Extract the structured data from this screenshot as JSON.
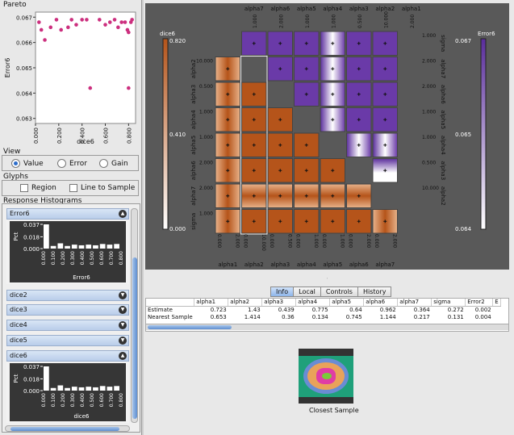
{
  "pareto": {
    "title": "Pareto",
    "ylabel": "Error6",
    "xlabel": "dice6",
    "y_ticks": [
      "0.067",
      "0.066",
      "0.065",
      "0.064",
      "0.063"
    ],
    "x_ticks": [
      "0.000",
      "0.200",
      "0.400",
      "0.600",
      "0.800"
    ],
    "point_color": "#cc2f7e",
    "points": [
      {
        "x": 0.03,
        "y": 0.0668
      },
      {
        "x": 0.05,
        "y": 0.0665
      },
      {
        "x": 0.08,
        "y": 0.0661
      },
      {
        "x": 0.13,
        "y": 0.0666
      },
      {
        "x": 0.18,
        "y": 0.0669
      },
      {
        "x": 0.22,
        "y": 0.0665
      },
      {
        "x": 0.28,
        "y": 0.0666
      },
      {
        "x": 0.31,
        "y": 0.0669
      },
      {
        "x": 0.35,
        "y": 0.0667
      },
      {
        "x": 0.4,
        "y": 0.0669
      },
      {
        "x": 0.44,
        "y": 0.0669
      },
      {
        "x": 0.47,
        "y": 0.0642
      },
      {
        "x": 0.55,
        "y": 0.0669
      },
      {
        "x": 0.6,
        "y": 0.0667
      },
      {
        "x": 0.64,
        "y": 0.0668
      },
      {
        "x": 0.68,
        "y": 0.0669
      },
      {
        "x": 0.71,
        "y": 0.0666
      },
      {
        "x": 0.74,
        "y": 0.0668
      },
      {
        "x": 0.77,
        "y": 0.0668
      },
      {
        "x": 0.79,
        "y": 0.0665
      },
      {
        "x": 0.8,
        "y": 0.0664
      },
      {
        "x": 0.82,
        "y": 0.0668
      },
      {
        "x": 0.8,
        "y": 0.0642
      },
      {
        "x": 0.83,
        "y": 0.0669
      }
    ]
  },
  "view": {
    "title": "View",
    "options": [
      {
        "label": "Value",
        "selected": true
      },
      {
        "label": "Error",
        "selected": false
      },
      {
        "label": "Gain",
        "selected": false
      }
    ]
  },
  "glyphs": {
    "title": "Glyphs",
    "region_label": "Region",
    "line_label": "Line to Sample"
  },
  "histograms": {
    "title": "Response Histograms",
    "error6": {
      "name": "Error6",
      "ylabel": "Pct",
      "xlabel": "Error6",
      "y_ticks": [
        "0.037",
        "0.018",
        "0.000"
      ],
      "x_ticks": [
        "0.000",
        "0.100",
        "0.200",
        "0.300",
        "0.400",
        "0.500",
        "0.600",
        "0.700",
        "0.800"
      ],
      "bars": [
        0.037,
        0.004,
        0.008,
        0.004,
        0.006,
        0.005,
        0.006,
        0.005,
        0.007,
        0.006,
        0.007
      ]
    },
    "collapsed": [
      "dice2",
      "dice3",
      "dice4",
      "dice5"
    ],
    "dice6": {
      "name": "dice6",
      "ylabel": "Pct",
      "xlabel": "dice6",
      "y_ticks": [
        "0.037",
        "0.018",
        "0.000"
      ],
      "x_ticks": [
        "0.000",
        "0.100",
        "0.200",
        "0.300",
        "0.400",
        "0.500",
        "0.600",
        "0.700",
        "0.800"
      ],
      "bars": [
        0.037,
        0.004,
        0.008,
        0.004,
        0.006,
        0.005,
        0.006,
        0.005,
        0.007,
        0.006,
        0.007
      ]
    }
  },
  "matrix": {
    "vars": [
      "alpha1",
      "alpha2",
      "alpha3",
      "alpha4",
      "alpha5",
      "alpha6",
      "alpha7",
      "sigma"
    ],
    "top_labels": [
      "alpha7",
      "alpha6",
      "alpha5",
      "alpha4",
      "alpha3",
      "alpha2",
      "alpha1"
    ],
    "top_tick_labels": [
      "1.000",
      "2.000",
      "1.000",
      "1.000",
      "0.500",
      "10.000",
      "2.000"
    ],
    "bottom_labels": [
      "alpha1",
      "alpha2",
      "alpha3",
      "alpha4",
      "alpha5",
      "alpha6",
      "alpha7"
    ],
    "bottom_tick_labels": [
      [
        "0.000",
        "2.000"
      ],
      [
        "0.000",
        "10.000"
      ],
      [
        "0.000",
        "0.500"
      ],
      [
        "0.000",
        "1.000"
      ],
      [
        "0.000",
        "1.000"
      ],
      [
        "0.000",
        "2.000"
      ],
      [
        "0.000",
        "2.000"
      ]
    ],
    "left_labels": [
      "alpha2",
      "alpha3",
      "alpha4",
      "alpha5",
      "alpha6",
      "alpha7",
      "sigma"
    ],
    "left_tick_labels": [
      "10.000",
      "0.500",
      "1.000",
      "1.000",
      "2.000",
      "2.000",
      "1.000"
    ],
    "right_labels": [
      "sigma",
      "alpha7",
      "alpha6",
      "alpha5",
      "alpha4",
      "alpha3",
      "alpha2"
    ],
    "right_tick_labels": [
      "1.000",
      "2.000",
      "2.000",
      "1.000",
      "1.000",
      "0.500",
      "10.000"
    ],
    "left_scale": {
      "label": "dice6",
      "max": "0.820",
      "mid": "0.410",
      "min": "0.000",
      "color": "#b5541a"
    },
    "right_scale": {
      "label": "Error6",
      "max": "0.067",
      "mid": "0.065",
      "min": "0.064",
      "color": "#5a2d9c"
    }
  },
  "tabs": [
    "Info",
    "Local",
    "Controls",
    "History"
  ],
  "active_tab": "Info",
  "info_table": {
    "columns": [
      "",
      "alpha1",
      "alpha2",
      "alpha3",
      "alpha4",
      "alpha5",
      "alpha6",
      "alpha7",
      "sigma",
      "Error2",
      "E"
    ],
    "rows": [
      [
        "Estimate",
        "0.723",
        "1.43",
        "0.439",
        "0.775",
        "0.64",
        "0.962",
        "0.364",
        "0.272",
        "0.002",
        ""
      ],
      [
        "Nearest Sample",
        "0.653",
        "1.414",
        "0.36",
        "0.134",
        "0.745",
        "1.144",
        "0.217",
        "0.131",
        "0.004",
        ""
      ]
    ]
  },
  "closest_sample_label": "Closest Sample"
}
